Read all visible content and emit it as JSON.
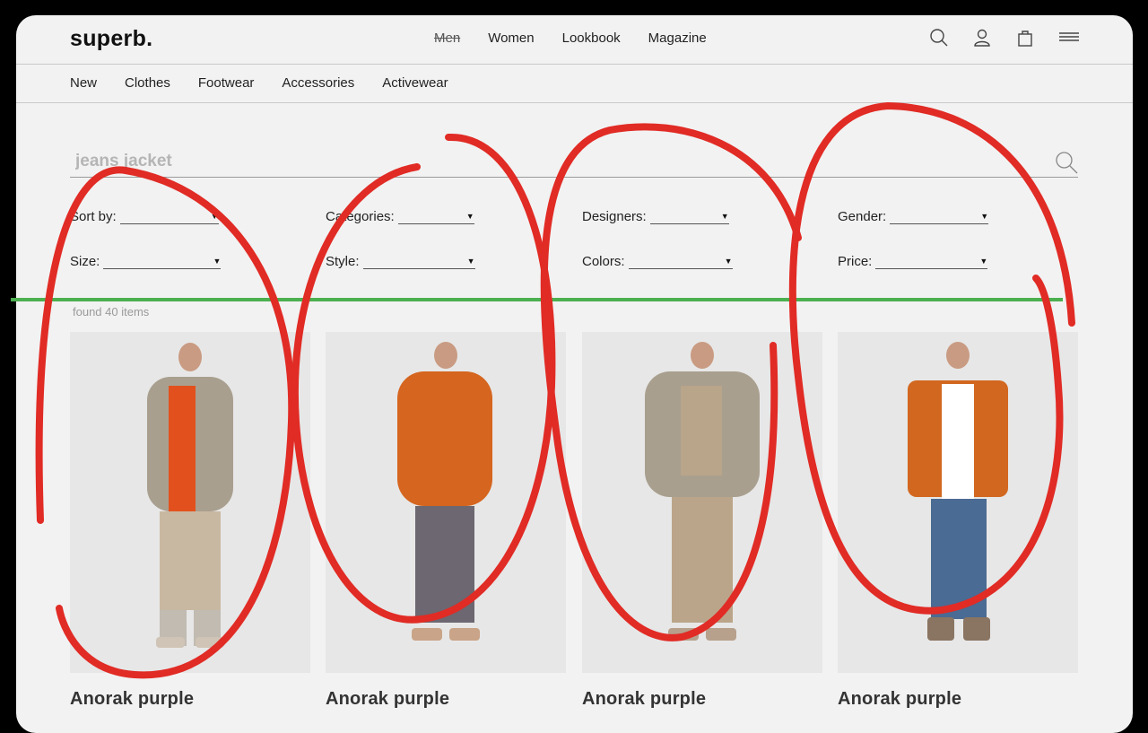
{
  "header": {
    "logo": "superb.",
    "nav": [
      {
        "label": "Men",
        "struck": true
      },
      {
        "label": "Women",
        "struck": false
      },
      {
        "label": "Lookbook",
        "struck": false
      },
      {
        "label": "Magazine",
        "struck": false
      }
    ],
    "icons": [
      "search-icon",
      "user-icon",
      "bag-icon",
      "menu-icon"
    ]
  },
  "subnav": [
    "New",
    "Clothes",
    "Footwear",
    "Accessories",
    "Activewear"
  ],
  "search": {
    "value": "jeans jacket"
  },
  "filters": {
    "sort": "Sort by:",
    "categories": "Categories:",
    "designers": "Designers:",
    "gender": "Gender:",
    "size": "Size:",
    "style": "Style:",
    "colors": "Colors:",
    "price": "Price:"
  },
  "results": {
    "found": "found 40 items"
  },
  "products": [
    {
      "name": "Anorak purple",
      "jacket": "#a99f8f",
      "accent": "#e2511d",
      "pants": "#c9b8a1"
    },
    {
      "name": "Anorak purple",
      "jacket": "#d5651f",
      "accent": "#d5651f",
      "pants": "#6c6770"
    },
    {
      "name": "Anorak purple",
      "jacket": "#a99f8f",
      "accent": "#b9a58a",
      "pants": "#bba58a"
    },
    {
      "name": "Anorak purple",
      "jacket": "#d2671f",
      "accent": "#ffffff",
      "pants": "#4a6b93"
    }
  ],
  "annotation": {
    "circle_color": "#e12b25",
    "line_color": "#4caf50"
  }
}
